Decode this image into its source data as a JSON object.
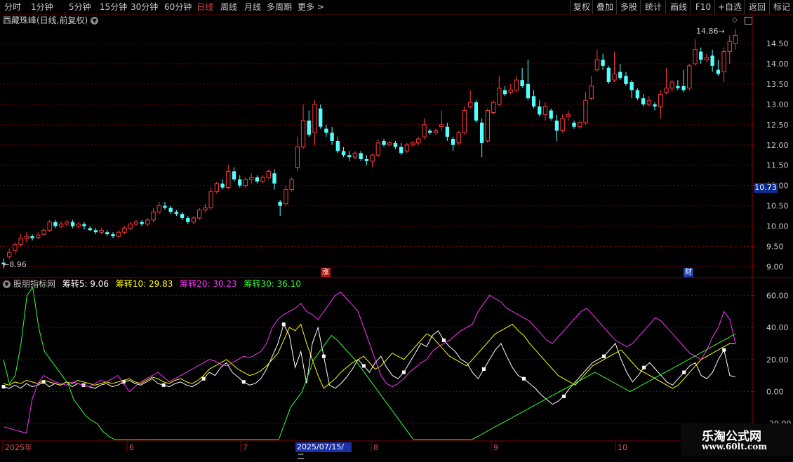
{
  "toolbar": {
    "periods": [
      "分时",
      "1分钟",
      "5分钟",
      "15分钟",
      "30分钟",
      "60分钟",
      "日线",
      "周线",
      "月线",
      "多周期",
      "更多"
    ],
    "active_period": "日线",
    "right_buttons": [
      "复权",
      "叠加",
      "多股",
      "统计",
      "画线",
      "F10",
      "+自选",
      "返回"
    ]
  },
  "stock": {
    "title": "西藏珠峰(日线,前复权)",
    "current_price": "10.73",
    "high_label": "14.86",
    "low_label": "8.96",
    "badge_zhang": "涨",
    "badge_cai": "财"
  },
  "indicator": {
    "name": "股朋指标网",
    "lines": [
      {
        "label": "筹转5: 9.06",
        "color": "#ffffff"
      },
      {
        "label": "筹转10: 29.83",
        "color": "#ffff00"
      },
      {
        "label": "筹转20: 30.23",
        "color": "#ff33ff"
      },
      {
        "label": "筹转30: 36.10",
        "color": "#33ff33"
      }
    ]
  },
  "price_axis": [
    "14.50",
    "14.00",
    "13.50",
    "13.00",
    "12.50",
    "12.00",
    "11.50",
    "11.00",
    "10.50",
    "10.00",
    "9.50",
    "9.00"
  ],
  "ind_axis": [
    "60.00",
    "40.00",
    "20.00",
    "0.00",
    "-20.00"
  ],
  "time_axis": [
    "2025年",
    "6",
    "7",
    "2025/07/15/二",
    "8",
    "9",
    "10"
  ],
  "watermark": {
    "line1": "乐淘公式网",
    "line2": "www.60lt.com"
  },
  "colors": {
    "up": "#ff3c3c",
    "down": "#54ffff",
    "grid": "#7a0000",
    "white": "#ffffff",
    "yellow": "#ffff00",
    "magenta": "#ff33ff",
    "green": "#33ff33"
  },
  "chart_data": {
    "type": "candlestick",
    "candles": [
      [
        9.1,
        9.06,
        9.2,
        8.96
      ],
      [
        9.25,
        9.35,
        9.45,
        9.2
      ],
      [
        9.4,
        9.55,
        9.6,
        9.3
      ],
      [
        9.55,
        9.7,
        9.8,
        9.5
      ],
      [
        9.7,
        9.75,
        9.85,
        9.6
      ],
      [
        9.75,
        9.7,
        9.8,
        9.65
      ],
      [
        9.72,
        9.78,
        9.85,
        9.68
      ],
      [
        9.8,
        9.9,
        9.95,
        9.75
      ],
      [
        9.9,
        10.1,
        10.15,
        9.85
      ],
      [
        10.1,
        10.0,
        10.15,
        9.95
      ],
      [
        10.0,
        10.05,
        10.12,
        9.95
      ],
      [
        10.05,
        10.1,
        10.15,
        9.98
      ],
      [
        10.1,
        10.0,
        10.15,
        9.95
      ],
      [
        10.0,
        10.05,
        10.1,
        9.95
      ],
      [
        10.05,
        10.0,
        10.1,
        9.92
      ],
      [
        9.95,
        9.9,
        10.0,
        9.88
      ],
      [
        9.9,
        9.85,
        9.95,
        9.8
      ],
      [
        9.85,
        9.9,
        9.95,
        9.8
      ],
      [
        9.85,
        9.8,
        9.9,
        9.75
      ],
      [
        9.8,
        9.75,
        9.85,
        9.7
      ],
      [
        9.75,
        9.85,
        9.9,
        9.72
      ],
      [
        9.85,
        9.95,
        10.0,
        9.8
      ],
      [
        9.95,
        10.05,
        10.1,
        9.9
      ],
      [
        10.05,
        10.1,
        10.15,
        10.0
      ],
      [
        10.1,
        10.05,
        10.15,
        10.0
      ],
      [
        10.05,
        10.15,
        10.2,
        10.0
      ],
      [
        10.15,
        10.35,
        10.45,
        10.1
      ],
      [
        10.35,
        10.5,
        10.6,
        10.3
      ],
      [
        10.5,
        10.45,
        10.6,
        10.4
      ],
      [
        10.45,
        10.35,
        10.5,
        10.3
      ],
      [
        10.35,
        10.3,
        10.4,
        10.25
      ],
      [
        10.3,
        10.2,
        10.35,
        10.15
      ],
      [
        10.2,
        10.1,
        10.25,
        10.05
      ],
      [
        10.1,
        10.2,
        10.25,
        10.05
      ],
      [
        10.2,
        10.4,
        10.45,
        10.15
      ],
      [
        10.4,
        10.45,
        10.55,
        10.35
      ],
      [
        10.45,
        10.85,
        10.95,
        10.4
      ],
      [
        10.85,
        11.05,
        11.1,
        10.8
      ],
      [
        11.05,
        10.95,
        11.15,
        10.9
      ],
      [
        10.95,
        11.35,
        11.5,
        10.9
      ],
      [
        11.35,
        11.15,
        11.45,
        11.1
      ],
      [
        11.15,
        11.0,
        11.25,
        10.95
      ],
      [
        11.0,
        11.15,
        11.2,
        10.95
      ],
      [
        11.15,
        11.2,
        11.3,
        11.05
      ],
      [
        11.2,
        11.1,
        11.25,
        11.05
      ],
      [
        11.1,
        11.2,
        11.25,
        11.05
      ],
      [
        11.2,
        11.35,
        11.4,
        11.15
      ],
      [
        11.3,
        11.05,
        11.4,
        10.9
      ],
      [
        10.6,
        10.5,
        10.65,
        10.25
      ],
      [
        10.55,
        10.9,
        11.0,
        10.5
      ],
      [
        10.9,
        11.15,
        11.2,
        10.85
      ],
      [
        11.45,
        11.95,
        12.2,
        11.35
      ],
      [
        11.95,
        12.6,
        13.0,
        11.9
      ],
      [
        12.6,
        12.25,
        12.85,
        12.2
      ],
      [
        12.3,
        13.0,
        13.1,
        12.0
      ],
      [
        12.9,
        12.45,
        13.0,
        12.4
      ],
      [
        12.4,
        12.3,
        12.5,
        12.2
      ],
      [
        12.3,
        12.1,
        12.45,
        12.0
      ],
      [
        12.1,
        11.85,
        12.2,
        11.8
      ],
      [
        11.85,
        11.75,
        11.95,
        11.7
      ],
      [
        11.75,
        11.7,
        11.85,
        11.6
      ],
      [
        11.7,
        11.8,
        11.85,
        11.65
      ],
      [
        11.8,
        11.65,
        11.85,
        11.6
      ],
      [
        11.65,
        11.6,
        11.75,
        11.5
      ],
      [
        11.6,
        11.75,
        11.8,
        11.45
      ],
      [
        11.75,
        12.05,
        12.15,
        11.7
      ],
      [
        12.1,
        12.0,
        12.15,
        11.95
      ],
      [
        12.0,
        12.05,
        12.1,
        11.95
      ],
      [
        12.05,
        11.95,
        12.1,
        11.9
      ],
      [
        11.95,
        11.8,
        12.05,
        11.75
      ],
      [
        11.85,
        12.0,
        12.05,
        11.8
      ],
      [
        12.0,
        12.05,
        12.1,
        11.95
      ],
      [
        12.05,
        12.15,
        12.2,
        12.0
      ],
      [
        12.2,
        12.5,
        12.65,
        12.15
      ],
      [
        12.35,
        12.3,
        12.4,
        12.25
      ],
      [
        12.3,
        12.35,
        12.4,
        12.25
      ],
      [
        12.45,
        12.5,
        12.85,
        12.35
      ],
      [
        12.45,
        12.2,
        12.55,
        12.1
      ],
      [
        12.15,
        12.0,
        12.2,
        11.85
      ],
      [
        12.05,
        12.3,
        12.35,
        12.0
      ],
      [
        12.3,
        12.85,
        12.95,
        12.25
      ],
      [
        12.95,
        13.05,
        13.35,
        12.9
      ],
      [
        13.05,
        12.6,
        13.1,
        12.55
      ],
      [
        12.55,
        12.05,
        12.65,
        11.7
      ],
      [
        12.1,
        12.85,
        12.9,
        12.05
      ],
      [
        12.8,
        13.05,
        13.1,
        12.75
      ],
      [
        13.0,
        13.4,
        13.7,
        12.95
      ],
      [
        13.35,
        13.25,
        13.45,
        13.2
      ],
      [
        13.3,
        13.35,
        13.5,
        13.25
      ],
      [
        13.35,
        13.6,
        13.7,
        13.3
      ],
      [
        13.6,
        13.45,
        13.9,
        13.4
      ],
      [
        13.5,
        13.15,
        14.1,
        13.1
      ],
      [
        13.2,
        12.95,
        13.35,
        12.9
      ],
      [
        12.95,
        12.75,
        13.1,
        12.7
      ],
      [
        12.75,
        12.95,
        13.05,
        12.6
      ],
      [
        12.85,
        12.65,
        12.9,
        12.6
      ],
      [
        12.6,
        12.35,
        12.75,
        12.1
      ],
      [
        12.35,
        12.65,
        12.75,
        12.3
      ],
      [
        12.7,
        12.75,
        12.85,
        12.6
      ],
      [
        12.55,
        12.45,
        12.6,
        12.4
      ],
      [
        12.45,
        12.55,
        12.6,
        12.4
      ],
      [
        12.55,
        13.1,
        13.3,
        12.5
      ],
      [
        13.15,
        13.45,
        13.7,
        13.1
      ],
      [
        13.85,
        14.1,
        14.35,
        13.8
      ],
      [
        14.1,
        13.95,
        14.25,
        13.85
      ],
      [
        13.9,
        13.55,
        13.95,
        13.5
      ],
      [
        13.6,
        13.75,
        14.3,
        13.55
      ],
      [
        13.8,
        13.65,
        14.0,
        13.6
      ],
      [
        13.7,
        13.5,
        13.8,
        13.45
      ],
      [
        13.55,
        13.35,
        13.6,
        13.15
      ],
      [
        13.35,
        13.15,
        13.4,
        13.1
      ],
      [
        13.15,
        13.0,
        13.25,
        12.95
      ],
      [
        13.0,
        13.1,
        13.2,
        12.95
      ],
      [
        13.0,
        12.95,
        13.05,
        12.85
      ],
      [
        12.95,
        13.25,
        13.35,
        12.65
      ],
      [
        13.3,
        13.4,
        13.9,
        13.25
      ],
      [
        13.4,
        13.55,
        13.6,
        13.3
      ],
      [
        13.45,
        13.4,
        13.6,
        13.35
      ],
      [
        13.45,
        13.35,
        13.85,
        13.3
      ],
      [
        13.4,
        13.95,
        14.0,
        13.35
      ],
      [
        14.0,
        14.35,
        14.6,
        13.95
      ],
      [
        14.3,
        14.1,
        14.4,
        14.0
      ],
      [
        14.1,
        14.15,
        14.25,
        14.05
      ],
      [
        14.2,
        13.95,
        14.35,
        13.8
      ],
      [
        13.85,
        13.75,
        14.1,
        13.7
      ],
      [
        13.8,
        14.3,
        14.4,
        13.55
      ],
      [
        14.3,
        14.55,
        14.7,
        14.0
      ],
      [
        14.5,
        14.7,
        14.86,
        14.35
      ]
    ],
    "indicator_series": [
      {
        "name": "筹转5",
        "values": [
          3,
          2,
          4,
          2,
          5,
          3,
          4,
          6,
          3,
          5,
          4,
          6,
          3,
          5,
          4,
          3,
          2,
          4,
          5,
          3,
          4,
          6,
          7,
          5,
          4,
          6,
          8,
          5,
          4,
          3,
          5,
          6,
          4,
          3,
          5,
          8,
          12,
          10,
          15,
          18,
          12,
          9,
          6,
          4,
          5,
          8,
          14,
          22,
          30,
          42,
          35,
          15,
          25,
          5,
          30,
          40,
          22,
          4,
          2,
          5,
          9,
          14,
          20,
          16,
          12,
          18,
          22,
          15,
          10,
          8,
          12,
          18,
          24,
          30,
          28,
          35,
          38,
          32,
          28,
          25,
          20,
          18,
          12,
          8,
          14,
          20,
          26,
          30,
          22,
          15,
          10,
          8,
          5,
          2,
          -2,
          -5,
          -8,
          -6,
          -3,
          2,
          6,
          10,
          14,
          18,
          20,
          22,
          26,
          30,
          20,
          12,
          6,
          10,
          15,
          18,
          14,
          10,
          6,
          4,
          8,
          12,
          16,
          18,
          10,
          8,
          12,
          20,
          26,
          10,
          9.06
        ]
      },
      {
        "name": "筹转10",
        "values": [
          5,
          4,
          6,
          5,
          7,
          6,
          5,
          7,
          6,
          5,
          4,
          6,
          5,
          7,
          6,
          5,
          4,
          5,
          6,
          5,
          6,
          7,
          8,
          6,
          5,
          7,
          9,
          8,
          6,
          5,
          7,
          8,
          6,
          5,
          7,
          10,
          14,
          16,
          18,
          20,
          17,
          14,
          12,
          10,
          11,
          13,
          16,
          20,
          24,
          32,
          40,
          38,
          42,
          30,
          20,
          10,
          2,
          5,
          8,
          12,
          15,
          18,
          20,
          22,
          18,
          14,
          16,
          20,
          24,
          22,
          20,
          24,
          28,
          32,
          36,
          34,
          30,
          26,
          22,
          20,
          18,
          16,
          20,
          24,
          28,
          32,
          36,
          38,
          40,
          42,
          38,
          35,
          30,
          26,
          22,
          18,
          14,
          10,
          8,
          6,
          4,
          8,
          12,
          16,
          18,
          20,
          22,
          24,
          26,
          22,
          18,
          14,
          12,
          10,
          8,
          6,
          4,
          2,
          4,
          8,
          12,
          16,
          20,
          22,
          24,
          26,
          28,
          30,
          29.83
        ]
      },
      {
        "name": "筹转20",
        "values": [
          -22,
          -23,
          -24,
          -25,
          -26,
          -5,
          5,
          10,
          8,
          6,
          5,
          4,
          6,
          5,
          4,
          3,
          5,
          7,
          6,
          8,
          10,
          5,
          0,
          3,
          6,
          8,
          10,
          12,
          9,
          6,
          8,
          10,
          12,
          14,
          16,
          18,
          20,
          19,
          17,
          16,
          18,
          20,
          22,
          21,
          23,
          25,
          30,
          40,
          45,
          48,
          50,
          52,
          55,
          50,
          48,
          45,
          50,
          55,
          60,
          62,
          58,
          54,
          50,
          40,
          30,
          20,
          10,
          5,
          3,
          5,
          8,
          12,
          15,
          18,
          20,
          25,
          28,
          30,
          32,
          35,
          38,
          40,
          42,
          50,
          55,
          60,
          58,
          56,
          52,
          50,
          48,
          46,
          44,
          40,
          36,
          32,
          30,
          34,
          38,
          42,
          46,
          50,
          52,
          48,
          44,
          40,
          36,
          32,
          30,
          28,
          30,
          34,
          38,
          42,
          46,
          44,
          40,
          36,
          32,
          28,
          24,
          22,
          20,
          26,
          34,
          40,
          50,
          45,
          30.23
        ]
      },
      {
        "name": "筹转30",
        "values": [
          20,
          5,
          10,
          30,
          60,
          68,
          40,
          25,
          20,
          15,
          10,
          5,
          -5,
          -10,
          -15,
          -18,
          -20,
          -25,
          -28,
          -30,
          -32,
          -34,
          -36,
          -38,
          -40,
          -42,
          -45,
          -48,
          -50,
          -55,
          -60,
          -65,
          -70,
          -75,
          -80,
          -85,
          -88,
          -90,
          -92,
          -90,
          -88,
          -85,
          -80,
          -70,
          -60,
          -50,
          -40,
          -30,
          -20,
          -10,
          -5,
          0,
          10,
          20,
          25,
          30,
          35,
          32,
          28,
          24,
          20,
          15,
          10,
          5,
          0,
          -5,
          -10,
          -15,
          -20,
          -25,
          -30,
          -32,
          -34,
          -36,
          -38,
          -40,
          -38,
          -36,
          -34,
          -32,
          -30,
          -28,
          -26,
          -24,
          -22,
          -20,
          -18,
          -16,
          -14,
          -12,
          -10,
          -8,
          -6,
          -4,
          -2,
          0,
          2,
          4,
          6,
          8,
          10,
          12,
          10,
          8,
          6,
          4,
          2,
          0,
          2,
          4,
          6,
          8,
          10,
          12,
          14,
          16,
          18,
          20,
          22,
          24,
          26,
          28,
          30,
          32,
          34,
          36.1
        ]
      }
    ],
    "price_ylim": [
      8.8,
      14.95
    ],
    "indicator_ylim": [
      -30,
      65
    ]
  }
}
